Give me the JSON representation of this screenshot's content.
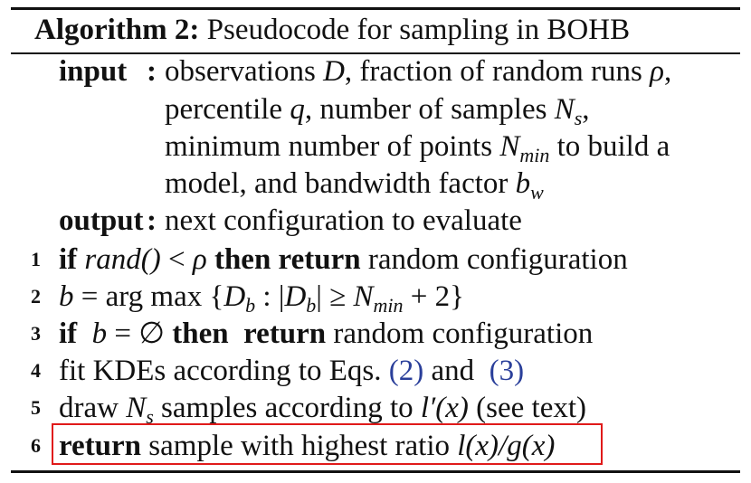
{
  "algorithm": {
    "label": "Algorithm 2:",
    "title": "Pseudocode for sampling in BOHB"
  },
  "input": {
    "keyword": "input",
    "colon": ":",
    "lines": [
      [
        "observations ",
        "D",
        ", fraction of random runs ",
        "ρ",
        ","
      ],
      [
        "percentile ",
        "q",
        ", number of samples ",
        "N",
        "s",
        ","
      ],
      [
        "minimum number of points ",
        "N",
        "min",
        " to build a"
      ],
      [
        "model, and bandwidth factor ",
        "b",
        "w"
      ]
    ]
  },
  "output": {
    "keyword": "output",
    "colon": ":",
    "text": "next configuration to evaluate"
  },
  "steps": [
    {
      "num": "1",
      "parts": [
        "if",
        "rand()",
        " < ",
        "ρ",
        " then return",
        " random configuration"
      ]
    },
    {
      "num": "2",
      "parts": [
        "b",
        " = arg max {",
        "D",
        "b",
        " : |",
        "D",
        "b",
        "| ≥ ",
        "N",
        "min",
        " + 2}"
      ]
    },
    {
      "num": "3",
      "parts": [
        "if",
        "  b",
        " = ∅ ",
        "then  return",
        " random configuration"
      ]
    },
    {
      "num": "4",
      "parts": [
        "fit KDEs according to Eqs. ",
        "(2)",
        " and  ",
        "(3)"
      ]
    },
    {
      "num": "5",
      "parts": [
        "draw ",
        "N",
        "s",
        " samples according to ",
        "l′(x)",
        " (see text)"
      ]
    },
    {
      "num": "6",
      "parts": [
        "return",
        " sample with highest ratio ",
        "l(x)/g(x)"
      ]
    }
  ],
  "colors": {
    "highlight": "#e01a1a",
    "cite": "#2a3f9a"
  }
}
